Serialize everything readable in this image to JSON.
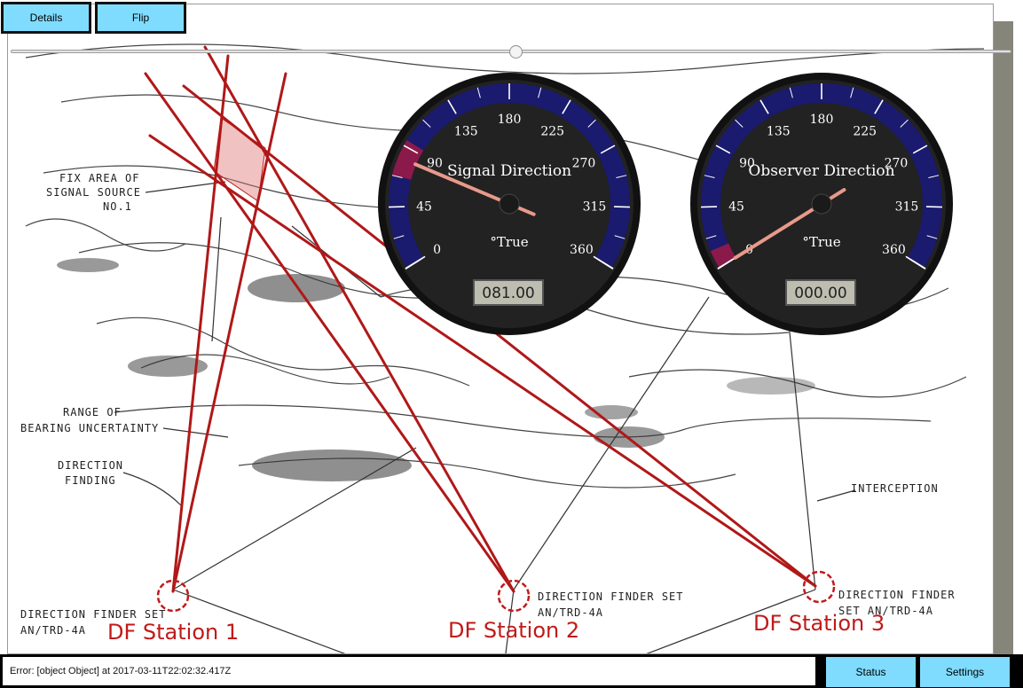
{
  "toolbar": {
    "details_label": "Details",
    "flip_label": "Flip"
  },
  "slider": {
    "position": 0.505
  },
  "map": {
    "labels": {
      "fix_area_1": "FIX AREA OF",
      "fix_area_2": "SIGNAL SOURCE",
      "fix_area_3": "NO.1",
      "range_1": "RANGE OF",
      "range_2": "BEARING UNCERTAINTY",
      "df_1": "DIRECTION",
      "df_2": "FINDING",
      "interception": "INTERCEPTION",
      "set1_1": "DIRECTION FINDER SET",
      "set1_2": "AN/TRD-4A",
      "set2_1": "DIRECTION FINDER SET",
      "set2_2": "AN/TRD-4A",
      "set3_1": "DIRECTION FINDER",
      "set3_2": "SET AN/TRD-4A"
    },
    "stations": [
      {
        "name": "DF Station 1"
      },
      {
        "name": "DF Station 2"
      },
      {
        "name": "DF Station 3"
      }
    ],
    "colors": {
      "bearing_line": "#b01818",
      "station_marker": "#c01a1a",
      "fix_area": "#e07878"
    }
  },
  "gauges": [
    {
      "title": "Signal Direction",
      "unit": "°True",
      "value_display": "081.00",
      "value": 81,
      "ticks": [
        "0",
        "45",
        "90",
        "135",
        "180",
        "225",
        "270",
        "315",
        "360"
      ],
      "range": [
        0,
        360
      ]
    },
    {
      "title": "Observer Direction",
      "unit": "°True",
      "value_display": "000.00",
      "value": 0,
      "ticks": [
        "0",
        "45",
        "90",
        "135",
        "180",
        "225",
        "270",
        "315",
        "360"
      ],
      "range": [
        0,
        360
      ]
    }
  ],
  "gauge_colors": {
    "face": "#222222",
    "band": "#1a1a6e",
    "needle": "#e89a8a",
    "highlight": "#8b1a4a",
    "tick": "#ffffff"
  },
  "status": {
    "error_text": "Error: [object Object] at 2017-03-11T22:02:32.417Z",
    "status_label": "Status",
    "settings_label": "Settings"
  }
}
